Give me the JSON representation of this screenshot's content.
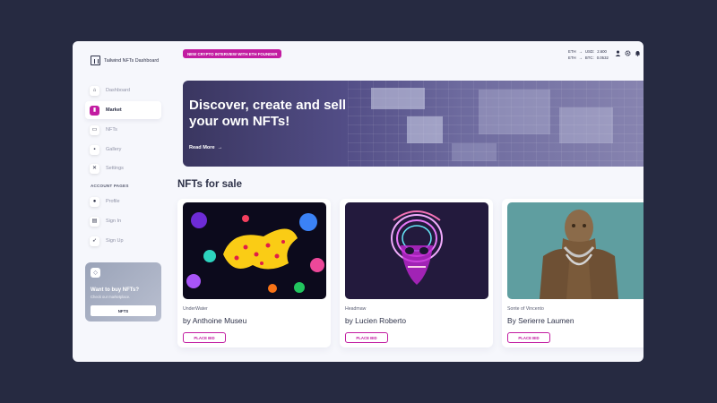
{
  "brand": {
    "name": "Tailwind NFTs Dashboard"
  },
  "sidebar": {
    "items": [
      {
        "label": "Dashboard",
        "icon": "home-icon"
      },
      {
        "label": "Market",
        "icon": "chart-icon",
        "active": true
      },
      {
        "label": "NFTs",
        "icon": "card-icon"
      },
      {
        "label": "Gallery",
        "icon": "image-icon"
      },
      {
        "label": "Settings",
        "icon": "wrench-icon"
      }
    ],
    "section_label": "ACCOUNT PAGES",
    "account_items": [
      {
        "label": "Profile",
        "icon": "user-icon"
      },
      {
        "label": "Sign In",
        "icon": "document-icon"
      },
      {
        "label": "Sign Up",
        "icon": "rocket-icon"
      }
    ],
    "promo": {
      "title": "Want to buy NFTs?",
      "subtitle": "Check our marketplace.",
      "button": "NFTS"
    }
  },
  "header": {
    "announcement": "NEW CRYPTO INTERVIEW WITH ETH FOUNDER",
    "rates": [
      {
        "from": "ETH",
        "to": "USD:",
        "value": "2.600"
      },
      {
        "from": "ETH",
        "to": "BTC:",
        "value": "0.0532"
      }
    ]
  },
  "hero": {
    "title": "Discover, create and sell your own NFTs!",
    "link": "Read More"
  },
  "section_title": "NFTs for sale",
  "cards": [
    {
      "collection": "UnderWater",
      "author": "by Anthoine Museu",
      "button": "PLACE BID"
    },
    {
      "collection": "Headmaw",
      "author": "by Lucien Roberto",
      "button": "PLACE BID"
    },
    {
      "collection": "Sonte of Vincento",
      "author": "By Serierre Laumen",
      "button": "PLACE BID"
    }
  ],
  "colors": {
    "accent": "#c21ca1",
    "text": "#2d3148",
    "background": "#262a41"
  }
}
